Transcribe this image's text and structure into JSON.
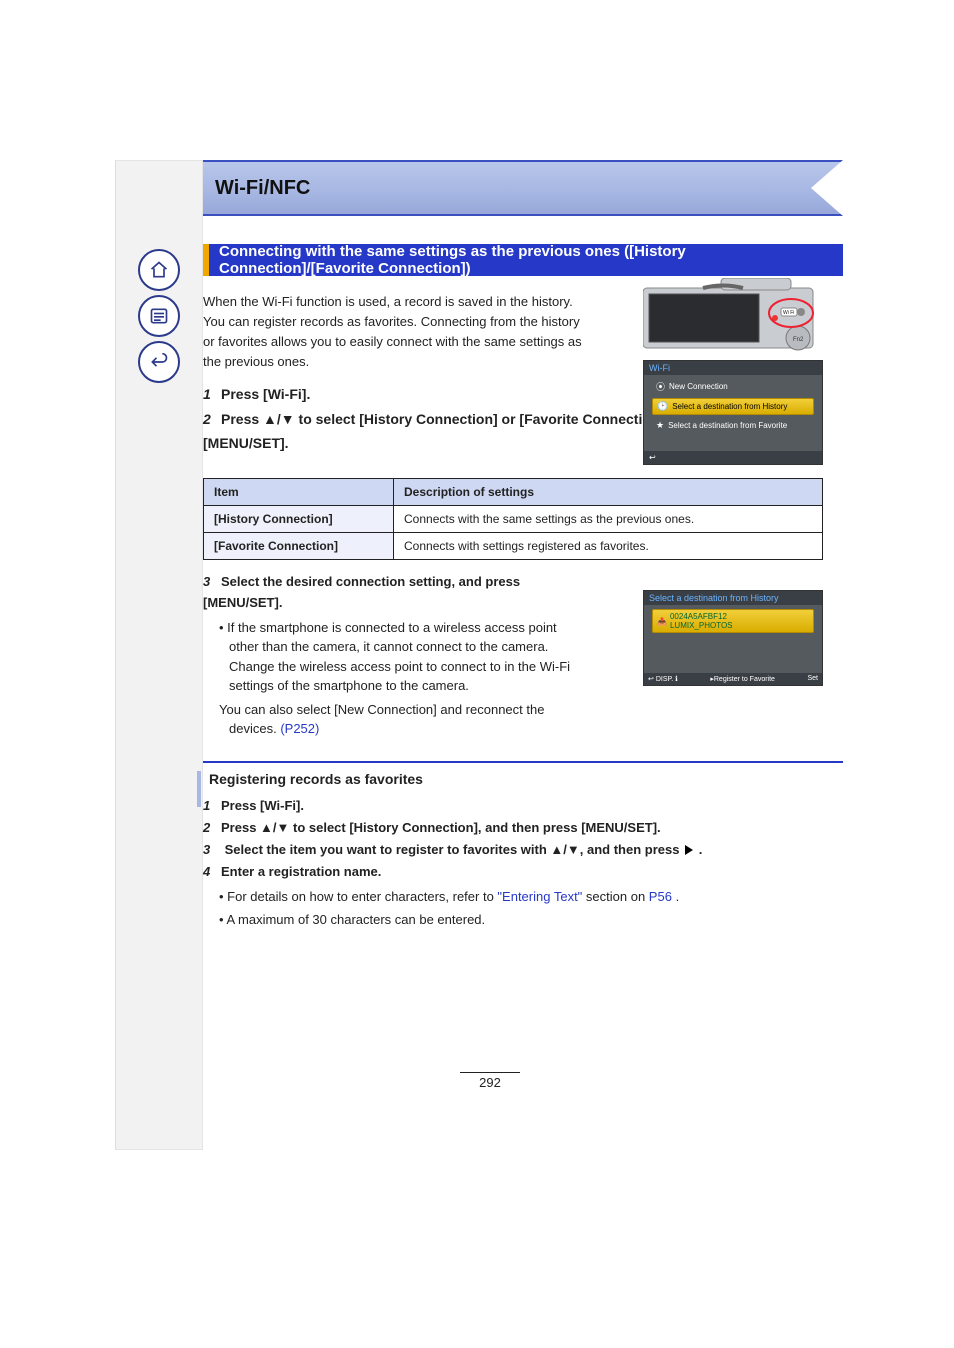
{
  "banner_title": "Wi-Fi/NFC",
  "section_title": "Connecting with the same settings as the previous ones ([History Connection]/[Favorite Connection])",
  "intro_text": "When the Wi-Fi function is used, a record is saved in the history. You can register records as favorites. Connecting from the history or favorites allows you to easily connect with the same settings as the previous ones.",
  "step1_num": "1",
  "step1_text": "Press [Wi-Fi].",
  "step2_num": "2",
  "step2_text": "Press ▲/▼ to select [History Connection] or [Favorite Connection], and then press [MENU/SET].",
  "table": {
    "h_item": "Item",
    "h_desc": "Description of settings",
    "r1_label": "[History Connection]",
    "r1_desc": "Connects with the same settings as the previous ones.",
    "r2_label": "[Favorite Connection]",
    "r2_desc": "Connects with settings registered as favorites."
  },
  "step3_num": "3",
  "step3_text": "Select the desired connection setting, and press [MENU/SET].",
  "step3_bullet": "• If the smartphone is connected to a wireless access point other than the camera, it cannot connect to the camera. Change the wireless access point to connect to in the Wi-Fi settings of the smartphone to the camera.",
  "step3_bullet2a": "You can also select [New Connection] and reconnect the devices.",
  "step3_bullet2b": "(P252)",
  "step3_bullet2_page": 252,
  "wifi_screen": {
    "title": "Wi-Fi",
    "item_new": "New Connection",
    "item_history": "Select a destination from History",
    "item_favorite": "Select a destination from Favorite"
  },
  "history_screen": {
    "title": "Select a destination from History",
    "entry_id": "0024A5AFBF12",
    "entry_name": "LUMIX_PHOTOS",
    "btn_disp": "DISP.",
    "btn_reg": "Register to Favorite",
    "btn_set": "Set"
  },
  "sub_title": "Registering records as favorites",
  "sub_step1_num": "1",
  "sub_step1": "Press [Wi-Fi].",
  "sub_step2_num": "2",
  "sub_step2": "Press ▲/▼ to select [History Connection], and then press [MENU/SET].",
  "sub_step3_num": "3",
  "sub_step3a": "Select the item you want to register to favorites with ▲/▼, and then press ",
  "sub_step3b": ".",
  "sub_step4_num": "4",
  "sub_step4": "Enter a registration name.",
  "sub_bullet1a": "For details on how to enter characters, refer to ",
  "sub_bullet1b": "\"Entering Text\"",
  "sub_bullet1c": " section on ",
  "sub_bullet1d": "P56",
  "sub_bullet1e": ".",
  "sub_bullet1_page": 56,
  "sub_bullet2": "A maximum of 30 characters can be entered.",
  "page_number": "292"
}
